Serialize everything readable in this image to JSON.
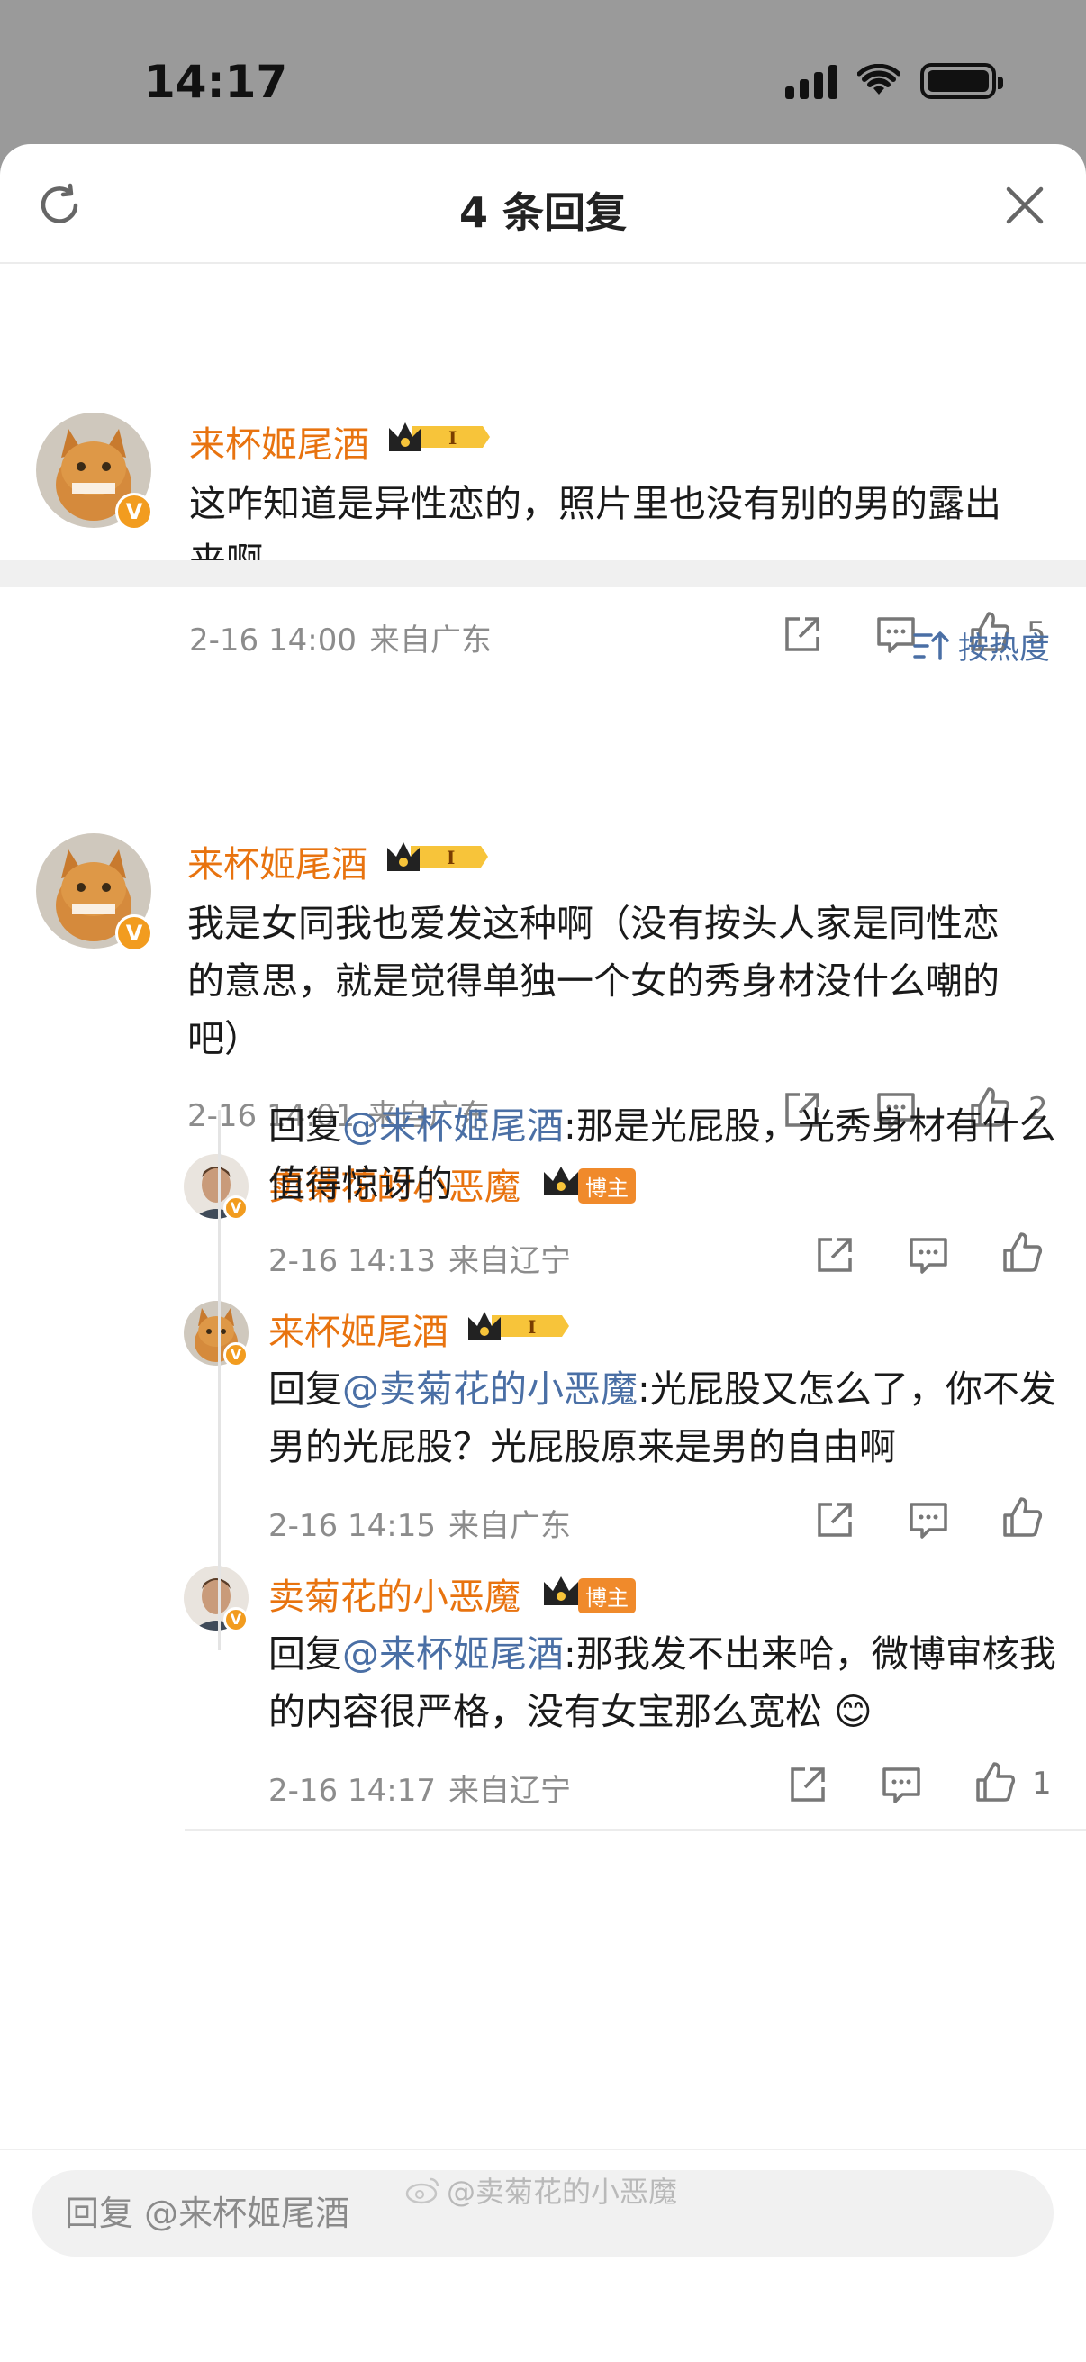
{
  "status": {
    "time": "14:17"
  },
  "header": {
    "title": "4 条回复"
  },
  "sort": {
    "label": "按热度"
  },
  "root_comment": {
    "username": "来杯姬尾酒",
    "text": "这咋知道是异性恋的，照片里也没有别的男的露出来啊",
    "date": "2-16 14:00",
    "location": "来自广东",
    "likes": "5"
  },
  "comment": {
    "username": "来杯姬尾酒",
    "text": "我是女同我也爱发这种啊（没有按头人家是同性恋的意思，就是觉得单独一个女的秀身材没什么嘲的吧）",
    "date": "2-16 14:01",
    "location": "来自广东",
    "likes": "2"
  },
  "replies": [
    {
      "username": "卖菊花的小恶魔",
      "badge": "博主",
      "reply_prefix": "回复",
      "mention": "@来杯姬尾酒",
      "text": ":那是光屁股，光秀身材有什么值得惊讶的",
      "date": "2-16 14:13",
      "location": "来自辽宁",
      "likes": ""
    },
    {
      "username": "来杯姬尾酒",
      "badge": "",
      "reply_prefix": "回复",
      "mention": "@卖菊花的小恶魔",
      "text": ":光屁股又怎么了，你不发男的光屁股？光屁股原来是男的自由啊",
      "date": "2-16 14:15",
      "location": "来自广东",
      "likes": ""
    },
    {
      "username": "卖菊花的小恶魔",
      "badge": "博主",
      "reply_prefix": "回复",
      "mention": "@来杯姬尾酒",
      "text": ":那我发不出来哈，微博审核我的内容很严格，没有女宝那么宽松 😊",
      "date": "2-16 14:17",
      "location": "来自辽宁",
      "likes": "1"
    }
  ],
  "input": {
    "placeholder": "回复 @来杯姬尾酒"
  },
  "watermark": "@卖菊花的小恶魔",
  "colors": {
    "username": "#e8730f",
    "mention": "#4a6fa5",
    "meta": "#8c8c8c",
    "badge": "#f29c1f"
  },
  "icons": {
    "share": "share-icon",
    "comment": "comment-icon",
    "like": "like-icon",
    "refresh": "refresh-icon",
    "close": "close-icon",
    "sort": "sort-icon"
  }
}
